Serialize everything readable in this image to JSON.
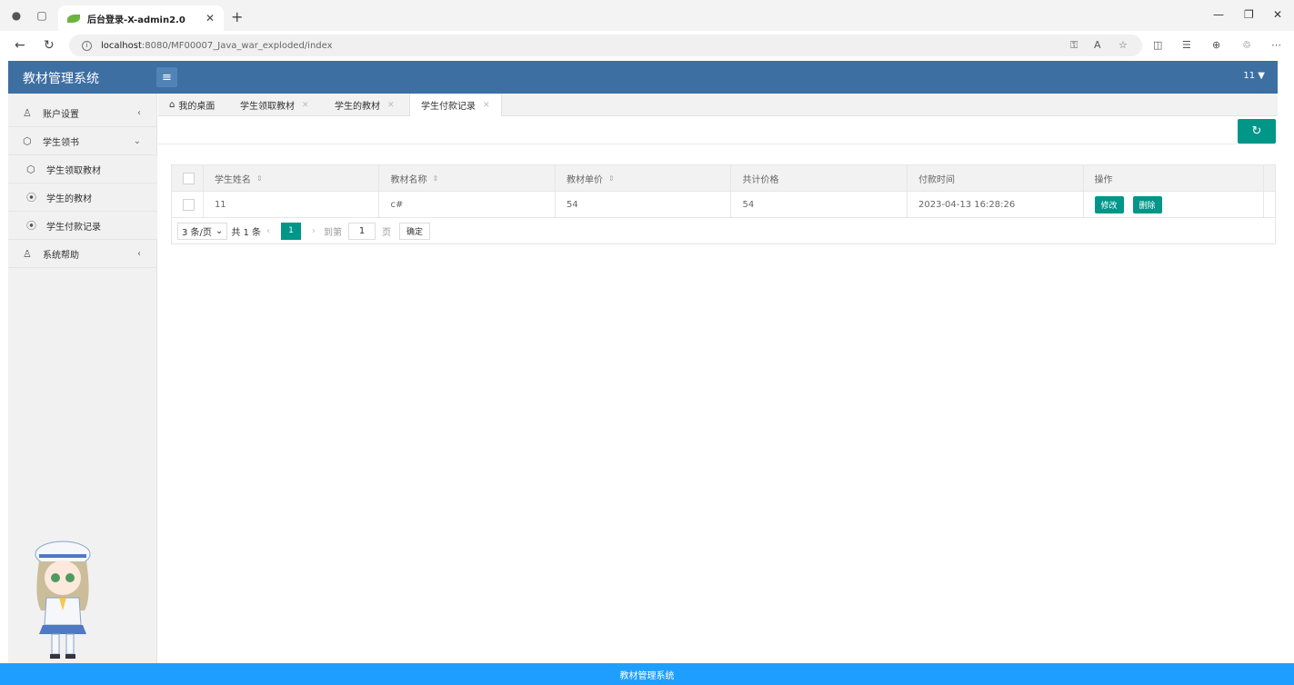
{
  "browser": {
    "tab_title": "后台登录-X-admin2.0",
    "url_host": "localhost",
    "url_rest": ":8080/MF00007_Java_war_exploded/index"
  },
  "app": {
    "logo": "教材管理系统",
    "user": "11",
    "footer": "教材管理系统"
  },
  "sidebar": {
    "items": [
      {
        "label": "账户设置",
        "icon": "user-icon"
      },
      {
        "label": "学生领书",
        "icon": "cube-icon"
      },
      {
        "label": "学生领取教材",
        "icon": "cube-icon"
      },
      {
        "label": "学生的教材",
        "icon": "circle-icon"
      },
      {
        "label": "学生付款记录",
        "icon": "circle-icon"
      },
      {
        "label": "系统帮助",
        "icon": "user-icon"
      }
    ]
  },
  "tabs": [
    {
      "label": "我的桌面"
    },
    {
      "label": "学生领取教材"
    },
    {
      "label": "学生的教材"
    },
    {
      "label": "学生付款记录"
    }
  ],
  "table": {
    "headers": [
      "学生姓名",
      "教材名称",
      "教材单价",
      "共计价格",
      "付款时间",
      "操作"
    ],
    "rows": [
      {
        "name": "11",
        "book": "c#",
        "price": "54",
        "total": "54",
        "time": "2023-04-13 16:28:26"
      }
    ],
    "edit_label": "修改",
    "delete_label": "删除"
  },
  "pager": {
    "page_size": "3 条/页",
    "total": "共 1 条",
    "current": "1",
    "goto_label": "到第",
    "goto_value": "1",
    "page_unit": "页",
    "confirm": "确定"
  },
  "colors": {
    "header": "#3d6fa3",
    "accent": "#009688",
    "footer": "#1e9fff"
  }
}
